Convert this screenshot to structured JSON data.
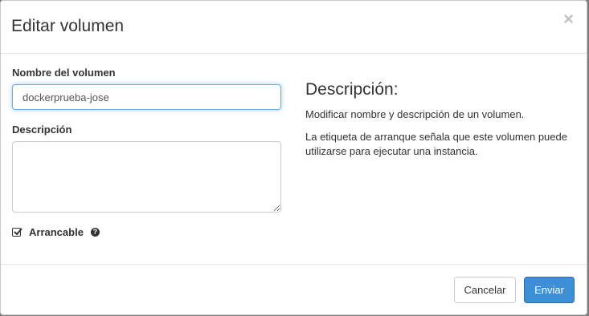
{
  "dialog": {
    "title": "Editar volumen",
    "close_glyph": "×"
  },
  "form": {
    "name_label": "Nombre del volumen",
    "name_value": "dockerprueba-jose",
    "description_label": "Descripción",
    "description_value": "",
    "bootable_label": "Arrancable",
    "bootable_checked": true,
    "help_glyph": "?"
  },
  "help_panel": {
    "title": "Descripción:",
    "paragraph1": "Modificar nombre y descripción de un volumen.",
    "paragraph2": "La etiqueta de arranque señala que este volumen puede utilizarse para ejecutar una instancia."
  },
  "footer": {
    "cancel_label": "Cancelar",
    "submit_label": "Enviar"
  },
  "colors": {
    "primary": "#3d8fd6",
    "focus_border": "#66afe9"
  }
}
